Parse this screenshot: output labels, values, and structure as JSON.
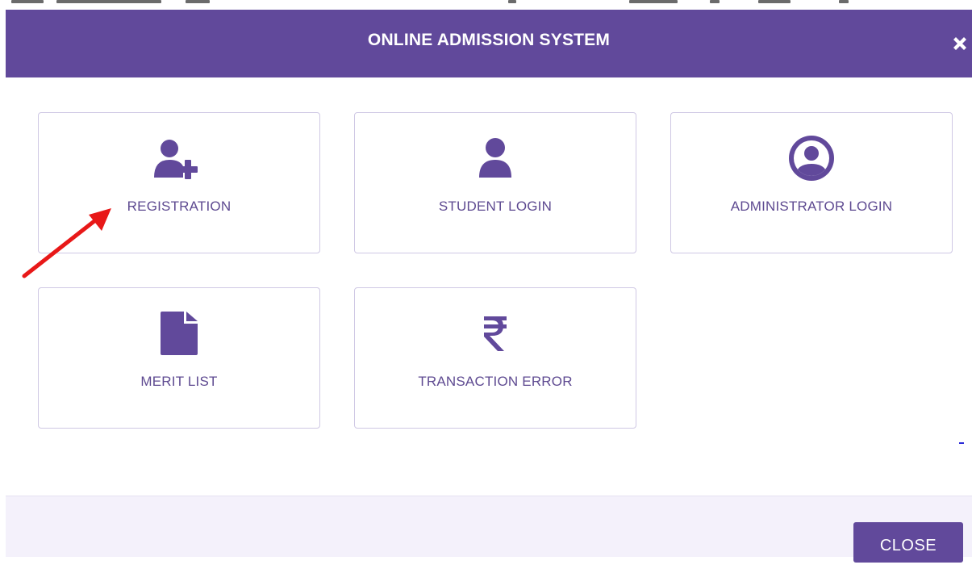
{
  "header": {
    "title": "ONLINE ADMISSION SYSTEM",
    "close_icon": "close-x-icon"
  },
  "menu": {
    "items": [
      {
        "label": "REGISTRATION",
        "icon": "user-plus-icon"
      },
      {
        "label": "STUDENT LOGIN",
        "icon": "user-icon"
      },
      {
        "label": "ADMINISTRATOR LOGIN",
        "icon": "user-circle-icon"
      },
      {
        "label": "MERIT LIST",
        "icon": "document-icon"
      },
      {
        "label": "TRANSACTION ERROR",
        "icon": "rupee-icon"
      }
    ]
  },
  "footer": {
    "close_label": "CLOSE"
  },
  "colors": {
    "primary": "#61499b",
    "label": "#5e4a91",
    "card_border": "#cfc8e4",
    "footer_bg": "#f4f1fb",
    "annotation_arrow": "#e81818"
  }
}
